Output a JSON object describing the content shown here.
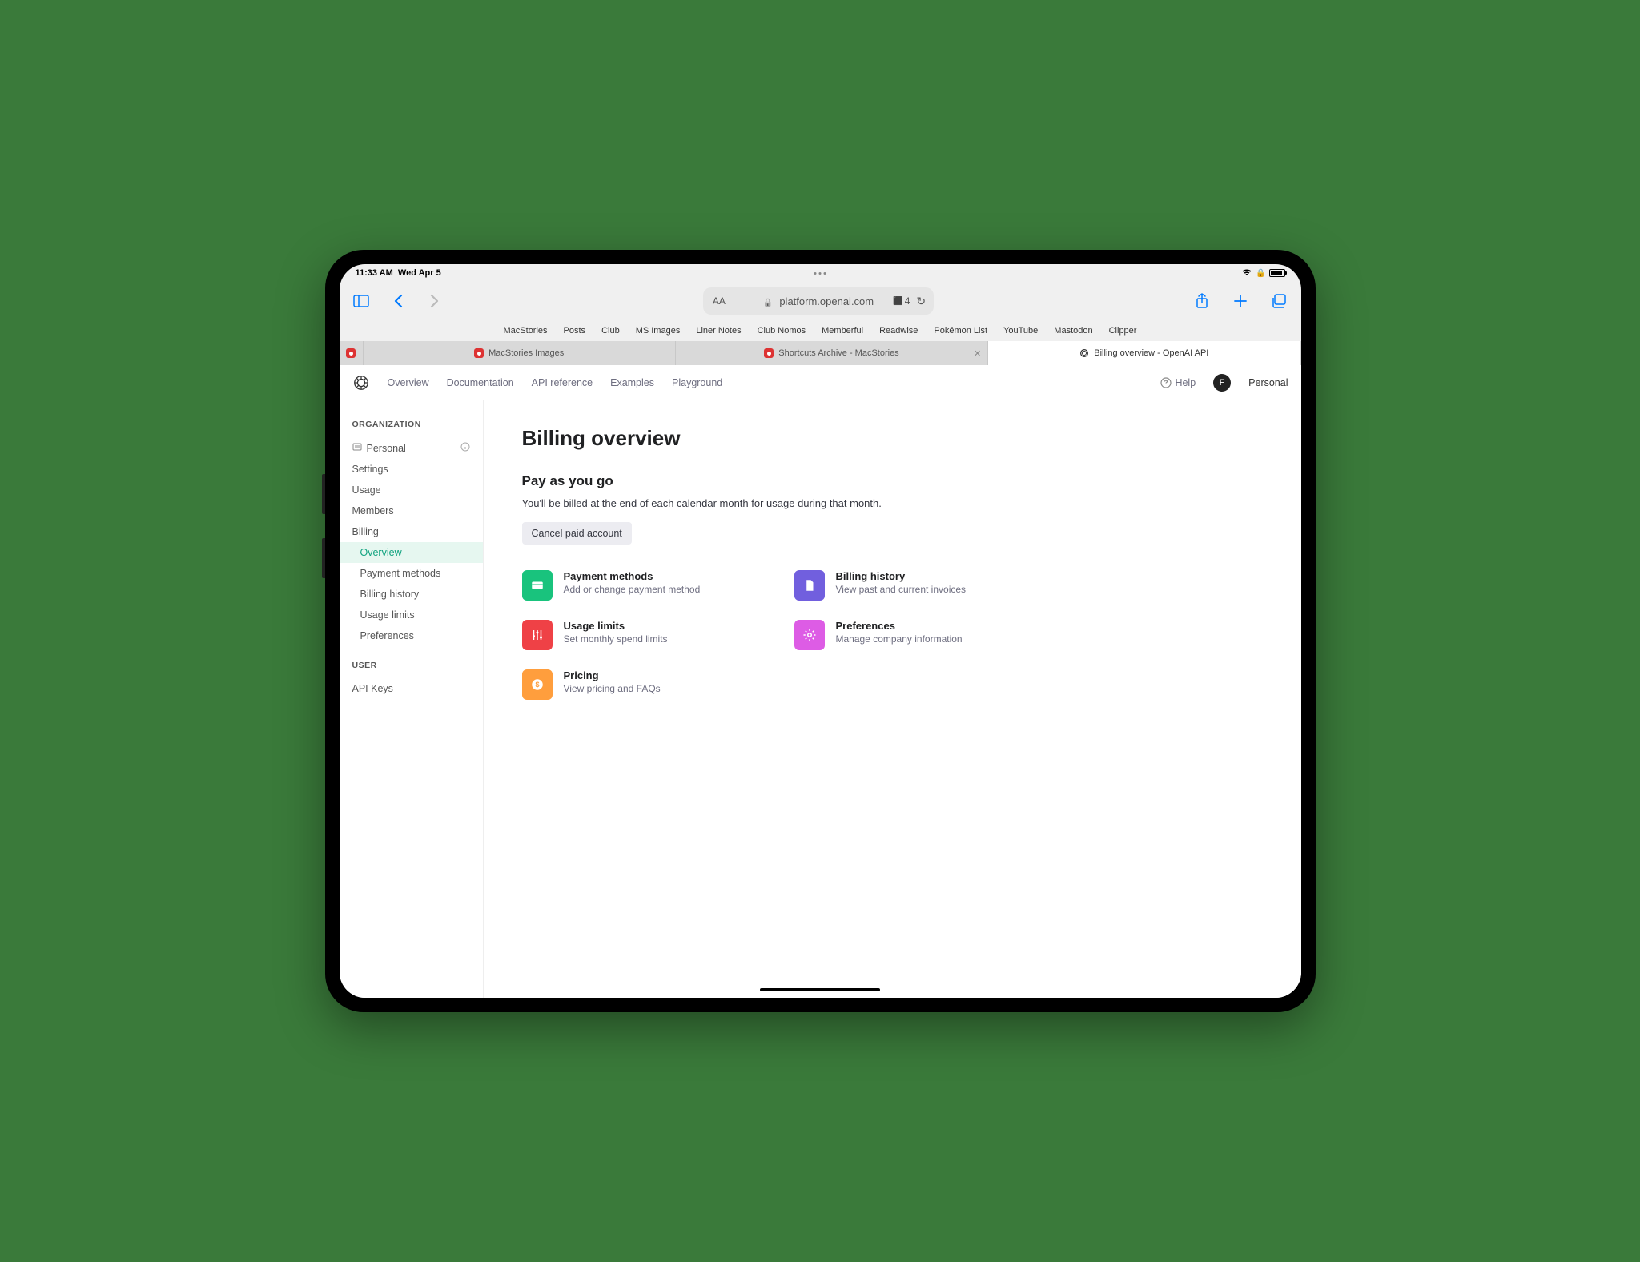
{
  "status": {
    "time": "11:33 AM",
    "date": "Wed Apr 5",
    "tab_count": "4"
  },
  "url": "platform.openai.com",
  "favorites": [
    "MacStories",
    "Posts",
    "Club",
    "MS Images",
    "Liner Notes",
    "Club Nomos",
    "Memberful",
    "Readwise",
    "Pokémon List",
    "YouTube",
    "Mastodon",
    "Clipper"
  ],
  "tabs": {
    "t1": "MacStories Images",
    "t2": "Shortcuts Archive - MacStories",
    "t3": "Billing overview - OpenAI API"
  },
  "nav": {
    "items": [
      "Overview",
      "Documentation",
      "API reference",
      "Examples",
      "Playground"
    ],
    "help": "Help",
    "avatar_initial": "F",
    "username": "Personal"
  },
  "sidebar": {
    "org_label": "ORGANIZATION",
    "personal": "Personal",
    "items": {
      "settings": "Settings",
      "usage": "Usage",
      "members": "Members",
      "billing": "Billing"
    },
    "billing_sub": {
      "overview": "Overview",
      "payment": "Payment methods",
      "history": "Billing history",
      "limits": "Usage limits",
      "prefs": "Preferences"
    },
    "user_label": "USER",
    "user_items": {
      "apikeys": "API Keys"
    }
  },
  "content": {
    "title": "Billing overview",
    "subtitle": "Pay as you go",
    "desc": "You'll be billed at the end of each calendar month for usage during that month.",
    "cancel": "Cancel paid account",
    "cards": {
      "payment": {
        "title": "Payment methods",
        "desc": "Add or change payment method"
      },
      "history": {
        "title": "Billing history",
        "desc": "View past and current invoices"
      },
      "limits": {
        "title": "Usage limits",
        "desc": "Set monthly spend limits"
      },
      "prefs": {
        "title": "Preferences",
        "desc": "Manage company information"
      },
      "pricing": {
        "title": "Pricing",
        "desc": "View pricing and FAQs"
      }
    }
  }
}
